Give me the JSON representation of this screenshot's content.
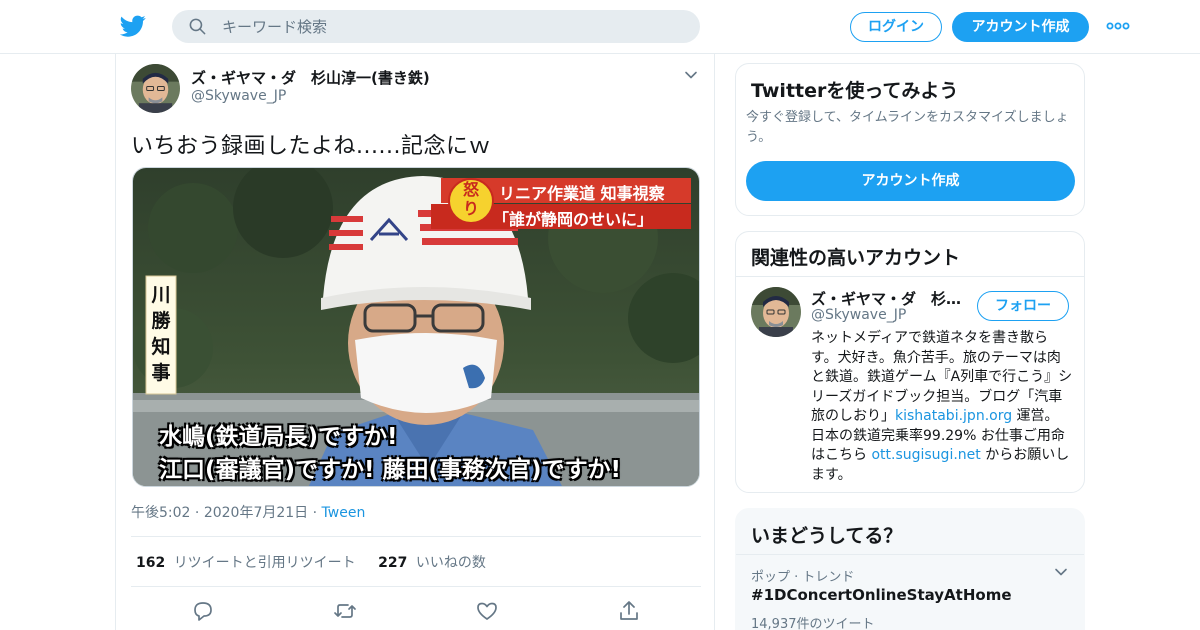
{
  "colors": {
    "brand": "#1da1f2",
    "link": "#1b95e0",
    "muted": "#657786",
    "text": "#14171a",
    "border": "#e6ecf0"
  },
  "header": {
    "logo_icon": "twitter-bird-icon",
    "search_placeholder": "キーワード検索",
    "login_label": "ログイン",
    "signup_label": "アカウント作成",
    "more_icon": "more-dots-icon"
  },
  "tweet": {
    "author_name": "ズ・ギヤマ・ダ　杉山淳一(書き鉄)",
    "author_handle": "@Skywave_JP",
    "text": "いちおう録画したよね......記念にｗ",
    "media": {
      "badge": "怒り",
      "caption_top_1": "リニア作業道  知事視察",
      "caption_top_2": "「誰が静岡のせいに」",
      "side_label": "川勝知事",
      "subtitle_1": "水嶋(鉄道局長)ですか!",
      "subtitle_2": "江口(審議官)ですか!  藤田(事務次官)ですか!"
    },
    "time": "午後5:02",
    "date": "2020年7月21日",
    "source": "Tween",
    "retweet_count": "162",
    "retweet_label": "リツイートと引用リツイート",
    "like_count": "227",
    "like_label": "いいねの数"
  },
  "sidebar": {
    "signup_card": {
      "title": "Twitterを使ってみよう",
      "description": "今すぐ登録して、タイムラインをカスタマイズしましょう。",
      "button": "アカウント作成"
    },
    "related": {
      "title": "関連性の高いアカウント",
      "name": "ズ・ギヤマ・ダ　杉山淳一(書き鉄)",
      "handle": "@Skywave_JP",
      "follow": "フォロー",
      "bio_1": "ネットメディアで鉄道ネタを書き散らす。犬好き。魚介苦手。旅のテーマは肉と鉄道。鉄道ゲーム『A列車で行こう』シリーズガイドブック担当。ブログ「汽車旅のしおり」",
      "bio_link_1": "kishatabi.jpn.org",
      "bio_2": " 運営。 日本の鉄道完乗率99.29% お仕事ご用命はこちら ",
      "bio_link_2": "ott.sugisugi.net",
      "bio_3": " からお願いします。"
    },
    "trends": {
      "title": "いまどうしてる？",
      "meta": "ポップ · トレンド",
      "name": "#1DConcertOnlineStayAtHome",
      "count": "14,937件のツイート"
    }
  }
}
